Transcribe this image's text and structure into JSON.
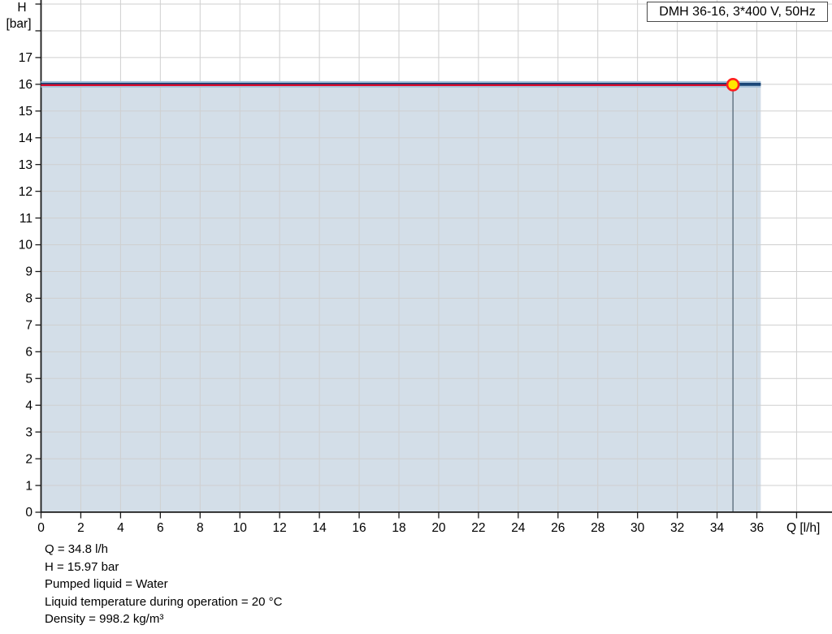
{
  "legend": {
    "label": "DMH 36-16, 3*400 V, 50Hz"
  },
  "footer": {
    "lines": [
      "Q = 34.8 l/h",
      "H = 15.97 bar",
      "Pumped liquid = Water",
      "Liquid temperature during operation = 20 °C",
      "Density = 998.2 kg/m³"
    ]
  },
  "chart_data": {
    "type": "line",
    "title": "",
    "xlabel": "Q [l/h]",
    "ylabel": "H [bar]",
    "ylabel_lines": [
      "H",
      "[bar]"
    ],
    "xlim": [
      0,
      39.8
    ],
    "ylim": [
      0,
      19.05
    ],
    "x_tick_step": 2,
    "x_tick_drawn_max": 38,
    "x_tick_label_max": 36,
    "y_tick_step": 1,
    "y_tick_drawn_max": 19,
    "y_tick_label_max": 17,
    "grid": true,
    "grid_color": "#cfcfcf",
    "axis_color": "#1a1a1a",
    "legend_position": "top-right",
    "series": [
      {
        "name": "DMH 36-16, 3*400 V, 50Hz",
        "color": "#1a4678",
        "halo_color": "#a8c2da",
        "width": 3.8,
        "x": [
          0,
          36.2
        ],
        "y": [
          16.0,
          16.0
        ],
        "area_fill": "#d3dee8"
      },
      {
        "name": "duty-highlight",
        "color": "#e30021",
        "width": 2.2,
        "x": [
          0,
          34.8
        ],
        "y": [
          15.97,
          15.97
        ]
      }
    ],
    "duty_point": {
      "q": 34.8,
      "h": 15.97,
      "marker_fill": "#ffe600",
      "marker_stroke": "#ff1e1e",
      "drop_line_color": "#5e6e7e"
    }
  }
}
